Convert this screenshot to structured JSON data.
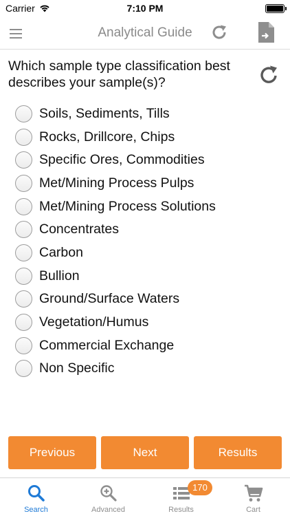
{
  "status_bar": {
    "carrier": "Carrier",
    "time": "7:10 PM"
  },
  "navbar": {
    "title": "Analytical Guide"
  },
  "question": {
    "text": "Which sample type classification best describes your sample(s)?"
  },
  "options": [
    {
      "label": "Soils, Sediments, Tills",
      "selected": false
    },
    {
      "label": "Rocks, Drillcore, Chips",
      "selected": false
    },
    {
      "label": "Specific Ores, Commodities",
      "selected": false
    },
    {
      "label": "Met/Mining Process Pulps",
      "selected": false
    },
    {
      "label": "Met/Mining Process Solutions",
      "selected": false
    },
    {
      "label": "Concentrates",
      "selected": false
    },
    {
      "label": "Carbon",
      "selected": false
    },
    {
      "label": "Bullion",
      "selected": false
    },
    {
      "label": "Ground/Surface Waters",
      "selected": false
    },
    {
      "label": "Vegetation/Humus",
      "selected": false
    },
    {
      "label": "Commercial Exchange",
      "selected": false
    },
    {
      "label": "Non Specific",
      "selected": false
    }
  ],
  "buttons": {
    "previous": "Previous",
    "next": "Next",
    "results": "Results"
  },
  "tabbar": {
    "tabs": [
      {
        "label": "Search",
        "icon": "search-icon",
        "active": true
      },
      {
        "label": "Advanced",
        "icon": "advanced-search-icon",
        "active": false
      },
      {
        "label": "Results",
        "icon": "list-icon",
        "active": false
      },
      {
        "label": "Cart",
        "icon": "cart-icon",
        "active": false
      }
    ],
    "results_badge": "170"
  },
  "colors": {
    "accent": "#f28a32",
    "tab_active": "#1e7ad6",
    "icon_gray": "#8e8e8e"
  }
}
